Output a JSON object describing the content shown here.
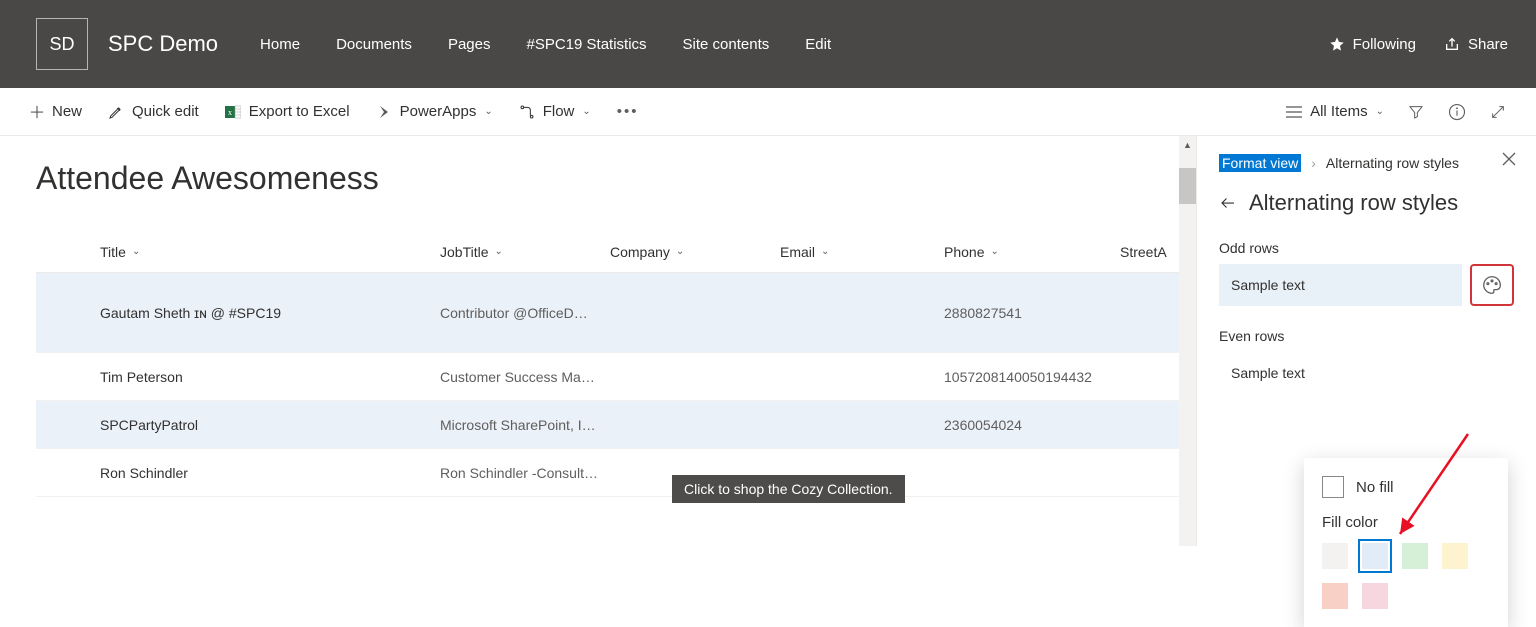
{
  "site": {
    "logo_text": "SD",
    "title": "SPC Demo",
    "nav": [
      "Home",
      "Documents",
      "Pages",
      "#SPC19 Statistics",
      "Site contents",
      "Edit"
    ],
    "follow_label": "Following",
    "share_label": "Share"
  },
  "commands": {
    "new": "New",
    "quick_edit": "Quick edit",
    "export": "Export to Excel",
    "powerapps": "PowerApps",
    "flow": "Flow",
    "view_label": "All Items"
  },
  "list": {
    "title": "Attendee Awesomeness",
    "columns": [
      "Title",
      "JobTitle",
      "Company",
      "Email",
      "Phone",
      "StreetA"
    ],
    "rows": [
      {
        "title": "Gautam Sheth ɪɴ @ #SPC19",
        "job": "Contributor @OfficeD…",
        "company": "",
        "email": "",
        "phone": "2880827541",
        "street": ""
      },
      {
        "title": "Tim Peterson",
        "job": "Customer Success Ma…",
        "company": "",
        "email": "",
        "phone": "1057208140050194432",
        "street": ""
      },
      {
        "title": "SPCPartyPatrol",
        "job": "Microsoft SharePoint, I…",
        "company": "",
        "email": "",
        "phone": "2360054024",
        "street": ""
      },
      {
        "title": "Ron Schindler",
        "job": "Ron Schindler -Consult…",
        "company": "",
        "email": "",
        "phone": "",
        "street": ""
      }
    ]
  },
  "panel": {
    "breadcrumb_root": "Format view",
    "breadcrumb_current": "Alternating row styles",
    "title": "Alternating row styles",
    "odd_label": "Odd rows",
    "even_label": "Even rows",
    "sample_text": "Sample text",
    "popout": {
      "no_fill": "No fill",
      "fill_color": "Fill color",
      "swatches": [
        "#f3f2f1",
        "#e1ecf8",
        "#d6f0d8",
        "#fdf3cf",
        "#f8d0c6",
        "#f6d6df"
      ],
      "selected_index": 1
    }
  },
  "tooltip": "Click to shop the Cozy Collection."
}
